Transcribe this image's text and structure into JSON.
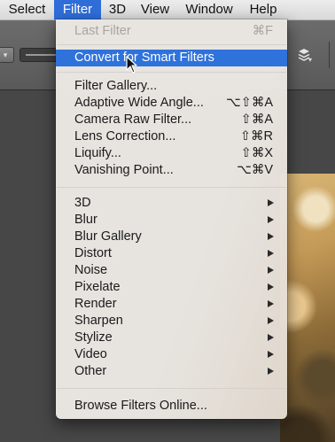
{
  "menubar": {
    "items": [
      {
        "label": "Select"
      },
      {
        "label": "Filter",
        "active": true
      },
      {
        "label": "3D"
      },
      {
        "label": "View"
      },
      {
        "label": "Window"
      },
      {
        "label": "Help"
      }
    ]
  },
  "filter_menu": {
    "last_filter": {
      "label": "Last Filter",
      "shortcut": "⌘F",
      "enabled": false
    },
    "convert": {
      "label": "Convert for Smart Filters",
      "highlighted": true
    },
    "group1": [
      {
        "label": "Filter Gallery...",
        "shortcut": ""
      },
      {
        "label": "Adaptive Wide Angle...",
        "shortcut": "⌥⇧⌘A"
      },
      {
        "label": "Camera Raw Filter...",
        "shortcut": "⇧⌘A"
      },
      {
        "label": "Lens Correction...",
        "shortcut": "⇧⌘R"
      },
      {
        "label": "Liquify...",
        "shortcut": "⇧⌘X"
      },
      {
        "label": "Vanishing Point...",
        "shortcut": "⌥⌘V"
      }
    ],
    "submenus": [
      {
        "label": "3D"
      },
      {
        "label": "Blur"
      },
      {
        "label": "Blur Gallery"
      },
      {
        "label": "Distort"
      },
      {
        "label": "Noise"
      },
      {
        "label": "Pixelate"
      },
      {
        "label": "Render"
      },
      {
        "label": "Sharpen"
      },
      {
        "label": "Stylize"
      },
      {
        "label": "Video"
      },
      {
        "label": "Other"
      }
    ],
    "browse": {
      "label": "Browse Filters Online..."
    }
  },
  "colors": {
    "highlight": "#2f72db",
    "menu_bg": "#ece9e5",
    "disabled_text": "#a8a5a1"
  },
  "icons": {
    "options_bar_dropdown": "chevron-down-icon",
    "options_bar_tool": "layers-icon",
    "submenu": "triangle-right-icon",
    "cursor": "arrow-cursor-icon"
  }
}
